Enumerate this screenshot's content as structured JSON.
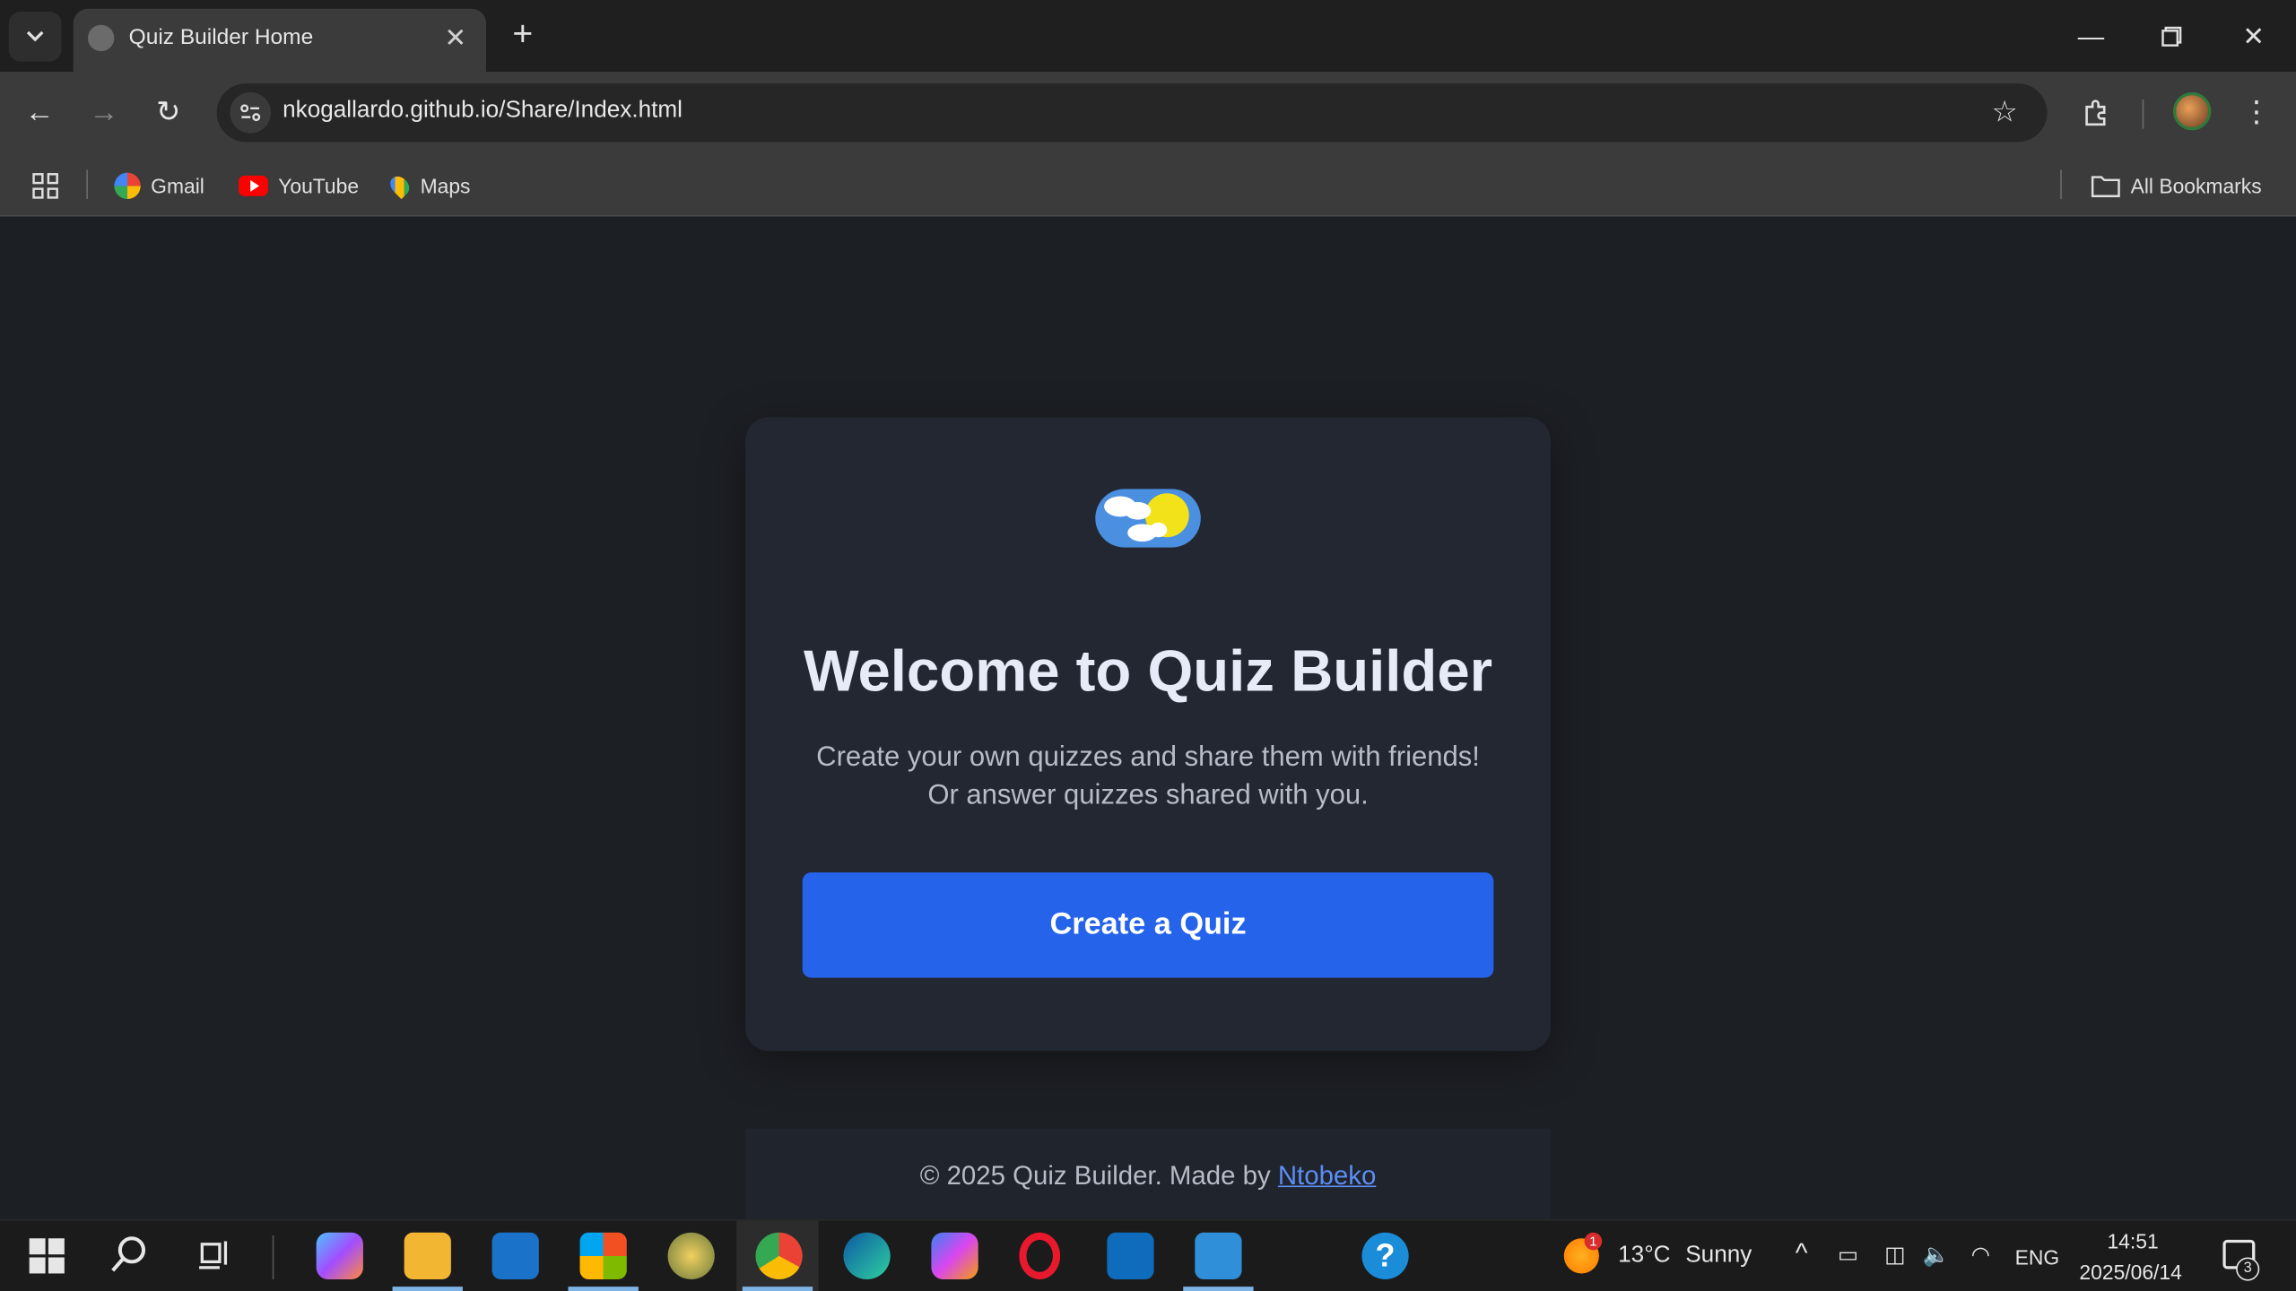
{
  "browser": {
    "tab_title": "Quiz Builder Home",
    "url": "nkogallardo.github.io/Share/Index.html",
    "bookmarks": [
      {
        "label": "Gmail",
        "icon": "google-icon"
      },
      {
        "label": "YouTube",
        "icon": "youtube-icon"
      },
      {
        "label": "Maps",
        "icon": "maps-icon"
      }
    ],
    "all_bookmarks": "All Bookmarks"
  },
  "page": {
    "headline": "Welcome to Quiz Builder",
    "subtext_line1": "Create your own quizzes and share them with friends!",
    "subtext_line2": "Or answer quizzes shared with you.",
    "cta_label": "Create a Quiz",
    "footer_prefix": "© 2025 Quiz Builder. Made by",
    "footer_link": "Ntobeko",
    "colors": {
      "accent": "#2563eb",
      "background": "#1c1f24",
      "card": "#232731",
      "link": "#5b8ef5"
    }
  },
  "taskbar": {
    "weather_temp": "13°C",
    "weather_text": "Sunny",
    "weather_badge": "1",
    "language": "ENG",
    "time": "14:51",
    "date": "2025/06/14",
    "notifications": "3"
  }
}
